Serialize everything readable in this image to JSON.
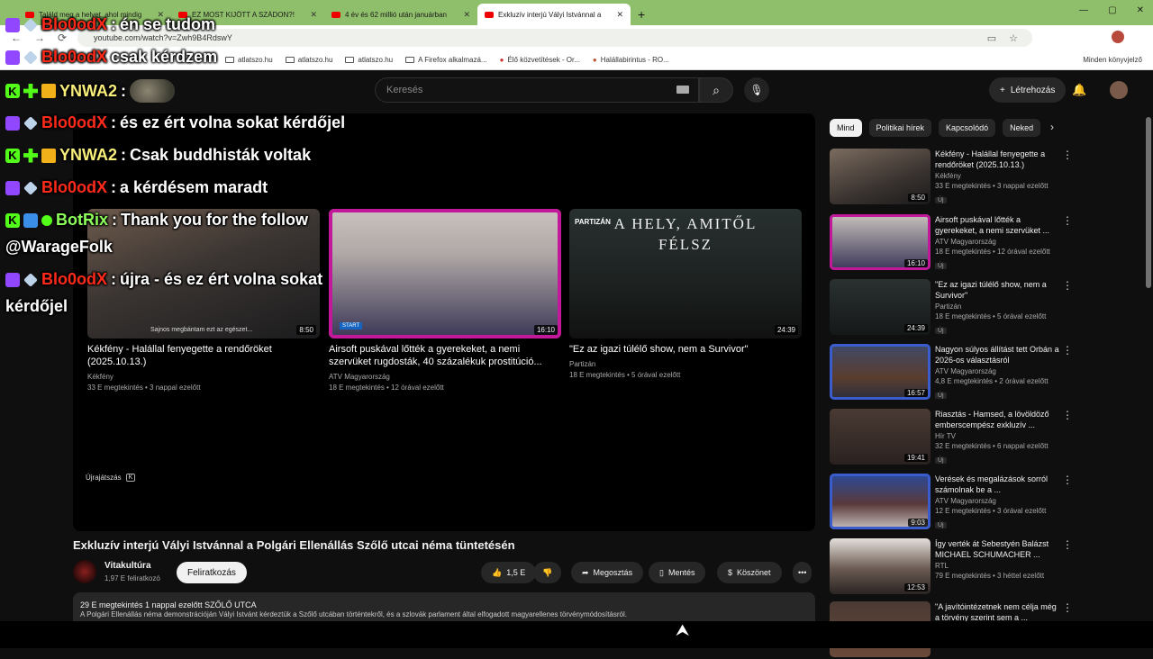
{
  "browser": {
    "tabs": [
      {
        "label": "Találd meg a helyet, ahol mindig",
        "close": "✕"
      },
      {
        "label": "EZ MOST KIJÖTT A SZÁDON?!",
        "close": "✕"
      },
      {
        "label": "4 év és 62 millió után januárban",
        "close": "✕"
      },
      {
        "label": "Exkluzív interjú Vályi Istvánnal a",
        "close": "✕"
      }
    ],
    "new_tab": "+",
    "window_controls": [
      "—",
      "▢",
      "✕"
    ],
    "url": "youtube.com/watch?v=Zwh9B4RdswY",
    "bookmarks": [
      "atlatszo.hu",
      "atlatszo.hu",
      "atlatszo.hu",
      "A Firefox alkalmazá...",
      "Élő közvetítések - Or...",
      "Halállabirintus - RO..."
    ],
    "bookmarks_right": "Minden könyvjelző"
  },
  "youtube": {
    "search_placeholder": "Keresés",
    "create_label": "Létrehozás",
    "player": {
      "end_cards": [
        {
          "title": "Kékfény - Halállal fenyegette a rendőröket (2025.10.13.)",
          "channel": "Kékfény",
          "meta": "33 E megtekintés • 3 nappal ezelőtt",
          "duration": "8:50",
          "overlay": "Sajnos megbántam ezt az egészet..."
        },
        {
          "title": "Airsoft puskával lőtték a gyerekeket, a nemi szervüket rugdosták, 40 százalékuk prostitúció...",
          "channel": "ATV Magyarország",
          "meta": "18 E megtekintés • 12 órával ezelőtt",
          "duration": "16:10",
          "overlay": "START"
        },
        {
          "title": "\"Ez az igazi túlélő show, nem a Survivor\"",
          "channel": "Partizán",
          "meta": "18 E megtekintés • 5 órával ezelőtt",
          "duration": "24:39",
          "overlay": "PARTIZÁN",
          "overlay_big": "A HELY, AMITŐL FÉLSZ"
        }
      ],
      "replay_label": "Újrajátszás",
      "replay_key": "K"
    },
    "video": {
      "title": "Exkluzív interjú Vályi Istvánnal a Polgári Ellenállás Szőlő utcai néma tüntetésén",
      "channel": "Vitakultúra",
      "subscribers": "1,97 E feliratkozó",
      "subscribe_label": "Feliratkozás",
      "likes": "1,5 E",
      "share_label": "Megosztás",
      "save_label": "Mentés",
      "thanks_label": "Köszönet",
      "more_label": "•••",
      "stats": "29 E megtekintés  1 nappal ezelőtt  SZŐLŐ UTCA",
      "description": "A Polgári Ellenállás néma demonstrációján Vályi Istvánt kérdeztük a Szőlő utcában történtekről, és a szlovák parlament által elfogadott magyarellenes törvénymódosításról."
    },
    "chips": [
      "Mind",
      "Politikai hírek",
      "Kapcsolódó",
      "Neked"
    ],
    "chip_arrow": "›",
    "recommendations": [
      {
        "title": "Kékfény - Halállal fenyegette a rendőröket (2025.10.13.)",
        "channel": "Kékfény",
        "meta": "33 E megtekintés • 3 nappal ezelőtt",
        "badge": "Új",
        "duration": "8:50"
      },
      {
        "title": "Airsoft puskával lőtték a gyerekeket, a nemi szervüket ...",
        "channel": "ATV Magyarország",
        "meta": "18 E megtekintés • 12 órával ezelőtt",
        "badge": "Új",
        "duration": "16:10"
      },
      {
        "title": "\"Ez az igazi túlélő show, nem a Survivor\"",
        "channel": "Partizán",
        "meta": "18 E megtekintés • 5 órával ezelőtt",
        "badge": "Új",
        "duration": "24:39"
      },
      {
        "title": "Nagyon súlyos állítást tett Orbán a 2026-os választásról",
        "channel": "ATV Magyarország",
        "meta": "4,8 E megtekintés • 2 órával ezelőtt",
        "badge": "Új",
        "duration": "16:57"
      },
      {
        "title": "Riasztás - Hamsed, a lövöldöző emberscempész exkluzív ...",
        "channel": "Hír TV",
        "meta": "32 E megtekintés • 6 nappal ezelőtt",
        "badge": "Új",
        "duration": "19:41"
      },
      {
        "title": "Verések és megalázások sorról számolnak be a ...",
        "channel": "ATV Magyarország",
        "meta": "12 E megtekintés • 3 órával ezelőtt",
        "badge": "Új",
        "duration": "9:03"
      },
      {
        "title": "Így verték át Sebestyén Balázst MICHAEL SCHUMACHER ...",
        "channel": "RTL",
        "meta": "79 E megtekintés • 3 héttel ezelőtt",
        "badge": "",
        "duration": "12:53"
      },
      {
        "title": "\"A javítóintézetnek nem célja még a törvény szerint sem a ...",
        "channel": "",
        "meta": "",
        "badge": "",
        "duration": ""
      }
    ]
  },
  "chat": [
    {
      "user": "Blo0odX",
      "sep": " : ",
      "msg": "én se tudom"
    },
    {
      "user": "Blo0odX",
      "sep": " : ",
      "msg": "csak kérdzem"
    },
    {
      "user": "YNWA2",
      "sep": " : ",
      "msg": ""
    },
    {
      "user": "Blo0odX",
      "sep": " : ",
      "msg": "és ez ért volna sokat kérdőjel"
    },
    {
      "user": "YNWA2",
      "sep": " : ",
      "msg": "Csak buddhisták voltak"
    },
    {
      "user": "Blo0odX",
      "sep": " : ",
      "msg": "a kérdésem maradt"
    },
    {
      "user": "BotRix",
      "sep": " : ",
      "msg": "Thank you for the follow"
    },
    {
      "user": "",
      "sep": "",
      "msg": "@WarageFolk"
    },
    {
      "user": "Blo0odX",
      "sep": " : ",
      "msg": "újra - és ez ért volna sokat"
    },
    {
      "user": "",
      "sep": "",
      "msg": "kérdőjel"
    }
  ]
}
